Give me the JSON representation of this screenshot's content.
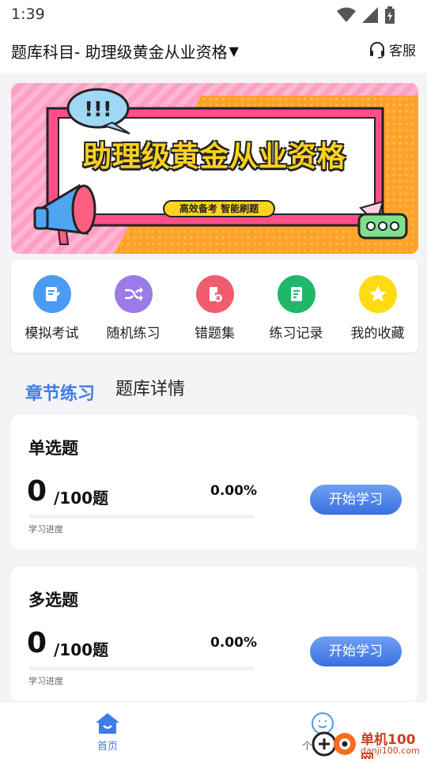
{
  "status_bar": {
    "time": "1:39"
  },
  "header": {
    "subject": "题库科目- 助理级黄金从业资格",
    "service_label": "客服"
  },
  "banner": {
    "title": "助理级黄金从业资格",
    "tagline": "高效备考 智能刷题"
  },
  "actions": [
    {
      "label": "模拟考试",
      "color": "#4a9cf2",
      "icon": "exam-icon"
    },
    {
      "label": "随机练习",
      "color": "#9b7be8",
      "icon": "shuffle-icon"
    },
    {
      "label": "错题集",
      "color": "#f25c6f",
      "icon": "wrong-questions-icon"
    },
    {
      "label": "练习记录",
      "color": "#1fb86a",
      "icon": "practice-record-icon"
    },
    {
      "label": "我的收藏",
      "color": "#ffdc12",
      "icon": "star-icon"
    }
  ],
  "tabs": {
    "active": "章节练习",
    "inactive": "题库详情"
  },
  "cards": [
    {
      "title": "单选题",
      "count": "0",
      "total": "/100题",
      "percent": "0.00%",
      "progress": 0,
      "sub": "学习进度",
      "button": "开始学习"
    },
    {
      "title": "多选题",
      "count": "0",
      "total": "/100题",
      "percent": "0.00%",
      "progress": 0,
      "sub": "学习进度",
      "button": "开始学习"
    }
  ],
  "bottom_nav": {
    "home": "首页",
    "me": "个人中心"
  },
  "watermark": {
    "line1": "单机100网",
    "line2": "danji100.com"
  },
  "colors": {
    "accent": "#3d7de8"
  }
}
